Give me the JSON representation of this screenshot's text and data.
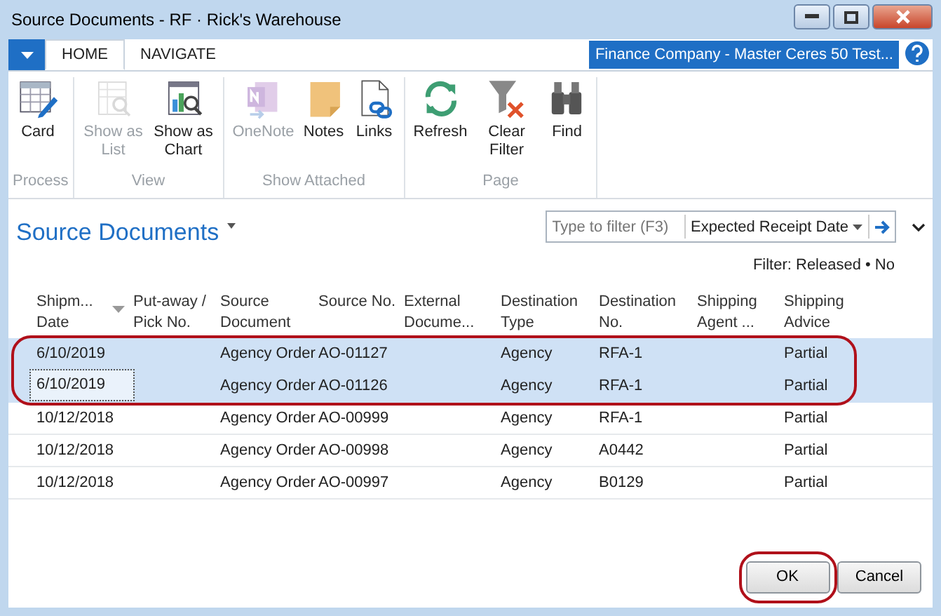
{
  "window": {
    "title": "Source Documents - RF · Rick's Warehouse"
  },
  "ribbon_tabs": [
    {
      "label": "HOME",
      "selected": true
    },
    {
      "label": "NAVIGATE",
      "selected": false
    }
  ],
  "company": "Finance Company - Master Ceres 50 Test...",
  "ribbon_groups": [
    {
      "label": "Process",
      "items": [
        {
          "label": "Card",
          "kind": "card",
          "disabled": false
        }
      ]
    },
    {
      "label": "View",
      "items": [
        {
          "label": "Show as List",
          "kind": "list",
          "disabled": true
        },
        {
          "label": "Show as Chart",
          "kind": "chart",
          "disabled": false
        }
      ]
    },
    {
      "label": "Show Attached",
      "items": [
        {
          "label": "OneNote",
          "kind": "onenote",
          "disabled": true
        },
        {
          "label": "Notes",
          "kind": "notes",
          "disabled": false
        },
        {
          "label": "Links",
          "kind": "links",
          "disabled": false
        }
      ]
    },
    {
      "label": "Page",
      "items": [
        {
          "label": "Refresh",
          "kind": "refresh",
          "disabled": false
        },
        {
          "label": "Clear Filter",
          "kind": "clearfilter",
          "disabled": false
        },
        {
          "label": "Find",
          "kind": "find",
          "disabled": false
        }
      ]
    }
  ],
  "page_title": "Source Documents",
  "filter": {
    "placeholder": "Type to filter (F3)",
    "field": "Expected Receipt Date"
  },
  "filter_summary": "Filter: Released • No",
  "table": {
    "columns": [
      "Shipm... Date",
      "Put-away / Pick No.",
      "Source Document",
      "Source No.",
      "External Docume...",
      "Destination Type",
      "Destination No.",
      "Shipping Agent ...",
      "Shipping Advice"
    ],
    "rows": [
      {
        "cells": [
          "6/10/2019",
          "",
          "Agency Order",
          "AO-01127",
          "",
          "Agency",
          "RFA-1",
          "",
          "Partial"
        ],
        "selected": true,
        "focused": false,
        "circled": true
      },
      {
        "cells": [
          "6/10/2019",
          "",
          "Agency Order",
          "AO-01126",
          "",
          "Agency",
          "RFA-1",
          "",
          "Partial"
        ],
        "selected": true,
        "focused": true,
        "circled": true
      },
      {
        "cells": [
          "10/12/2018",
          "",
          "Agency Order",
          "AO-00999",
          "",
          "Agency",
          "RFA-1",
          "",
          "Partial"
        ],
        "selected": false,
        "focused": false,
        "circled": false
      },
      {
        "cells": [
          "10/12/2018",
          "",
          "Agency Order",
          "AO-00998",
          "",
          "Agency",
          "A0442",
          "",
          "Partial"
        ],
        "selected": false,
        "focused": false,
        "circled": false
      },
      {
        "cells": [
          "10/12/2018",
          "",
          "Agency Order",
          "AO-00997",
          "",
          "Agency",
          "B0129",
          "",
          "Partial"
        ],
        "selected": false,
        "focused": false,
        "circled": false
      }
    ]
  },
  "buttons": [
    {
      "label": "OK",
      "circled": true
    },
    {
      "label": "Cancel",
      "circled": false
    }
  ]
}
